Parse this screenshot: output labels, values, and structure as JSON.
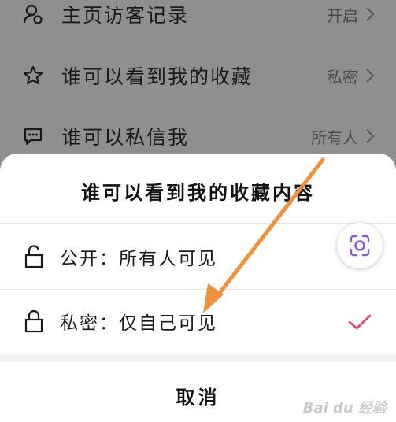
{
  "settings": {
    "rows": [
      {
        "label": "主页访客记录",
        "value": "开启",
        "icon": "person-clock-icon"
      },
      {
        "label": "谁可以看到我的收藏",
        "value": "私密",
        "icon": "star-icon"
      },
      {
        "label": "谁可以私信我",
        "value": "所有人",
        "icon": "message-icon"
      }
    ]
  },
  "sheet": {
    "title": "谁可以看到我的收藏内容",
    "options": [
      {
        "label": "公开：所有人可见",
        "icon": "unlocked-icon",
        "selected": false
      },
      {
        "label": "私密：仅自己可见",
        "icon": "locked-icon",
        "selected": true
      }
    ],
    "cancel_label": "取消"
  },
  "watermark": {
    "text": "Bai du 经验"
  },
  "colors": {
    "overlay_background": "#8f8f8f",
    "sheet_background": "#ffffff",
    "check_color": "#e8426b",
    "annotation_arrow": "#f0913a",
    "scan_accent": "#8a5bd6"
  }
}
